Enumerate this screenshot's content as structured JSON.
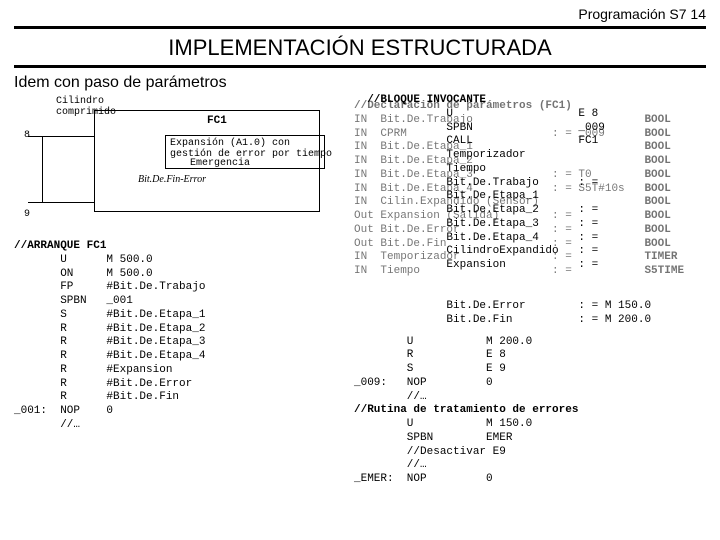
{
  "header": {
    "course": "Programación S7  14"
  },
  "title": "IMPLEMENTACIÓN ESTRUCTURADA",
  "subtitle": "Idem con paso de parámetros",
  "diagram": {
    "input_top": "Cilindro\ncomprimido",
    "fc_label": "FC1",
    "inner_text": "Expansión (A1.0) con\ngestión de error por tiempo",
    "port_in_top": "8",
    "port_in_bottom": "9",
    "out_top": "Emergencia",
    "out_bottom": "Error",
    "out_prefix": "Bit.De.Fin-"
  },
  "code_left": {
    "title": "//ARRANQUE FC1",
    "rows": [
      [
        "",
        "U",
        "M 500.0"
      ],
      [
        "",
        "ON",
        "M 500.0"
      ],
      [
        "",
        "FP",
        "#Bit.De.Trabajo"
      ],
      [
        "",
        "SPBN",
        "_001"
      ],
      [
        "",
        "S",
        "#Bit.De.Etapa_1"
      ],
      [
        "",
        "R",
        "#Bit.De.Etapa_2"
      ],
      [
        "",
        "R",
        "#Bit.De.Etapa_3"
      ],
      [
        "",
        "R",
        "#Bit.De.Etapa_4"
      ],
      [
        "",
        "R",
        "#Expansion"
      ],
      [
        "",
        "R",
        "#Bit.De.Error"
      ],
      [
        "",
        "R",
        "#Bit.De.Fin"
      ],
      [
        "_001:",
        "NOP",
        "0"
      ],
      [
        "",
        "//…",
        ""
      ]
    ]
  },
  "decl_back": {
    "title": "//Declaración de parámetros (FC1)",
    "rows": [
      [
        "IN",
        "Bit.De.Trabajo",
        "",
        "BOOL"
      ],
      [
        "IN",
        "CPRM",
        ": = _009",
        "BOOL"
      ],
      [
        "IN",
        "Bit.De.Etapa_1",
        "",
        "BOOL"
      ],
      [
        "IN",
        "Bit.De.Etapa_2",
        "",
        "BOOL"
      ],
      [
        "IN",
        "Bit.De.Etapa_3",
        ": = T0",
        "BOOL"
      ],
      [
        "IN",
        "Bit.De.Etapa_4",
        ": = S5T#10s",
        "BOOL"
      ],
      [
        "IN",
        "Cilin.Expandido (Sensor)",
        "",
        "BOOL"
      ],
      [
        "Out",
        "Expansion (Salida)",
        ": =",
        "BOOL"
      ],
      [
        "Out",
        "Bit.De.Error",
        ": =",
        "BOOL"
      ],
      [
        "Out",
        "Bit.De.Fin",
        ": =",
        "BOOL"
      ],
      [
        "IN",
        "Temporizador",
        ": =",
        "TIMER"
      ],
      [
        "IN",
        "Tiempo",
        ": =",
        "S5TIME"
      ]
    ],
    "tail": [
      [
        "",
        "Bit.De.Error",
        ": = M 150.0",
        ""
      ],
      [
        "",
        "Bit.De.Fin",
        ": = M 200.0",
        ""
      ]
    ]
  },
  "decl_front": {
    "title": "//BLOQUE INVOCANTE",
    "rows": [
      [
        "",
        "U",
        "E 8"
      ],
      [
        "",
        "SPBN",
        "_009"
      ],
      [
        "",
        "CALL",
        "FC1"
      ],
      [
        "",
        "Temporizador",
        ""
      ],
      [
        "",
        "Tiempo",
        ""
      ],
      [
        "",
        "Bit.De.Trabajo",
        ": ="
      ],
      [
        "",
        "Bit.De.Etapa_1",
        ""
      ],
      [
        "",
        "Bit.De.Etapa_2",
        ": ="
      ],
      [
        "",
        "Bit.De.Etapa_3",
        ": ="
      ],
      [
        "",
        "Bit.De.Etapa_4",
        ": ="
      ],
      [
        "",
        "CilindroExpandido",
        ": ="
      ],
      [
        "",
        "Expansion",
        ": ="
      ]
    ]
  },
  "code_right": {
    "rows": [
      [
        "",
        "U",
        "M 200.0"
      ],
      [
        "",
        "R",
        "E 8"
      ],
      [
        "",
        "S",
        "E 9"
      ],
      [
        "_009:",
        "NOP",
        "0"
      ],
      [
        "",
        "//…",
        ""
      ],
      [
        "//Rutina de tratamiento de errores",
        "",
        ""
      ],
      [
        "",
        "U",
        "M 150.0"
      ],
      [
        "",
        "SPBN",
        "EMER"
      ],
      [
        "",
        "//Desactivar E9",
        ""
      ],
      [
        "",
        "//…",
        ""
      ],
      [
        "_EMER:",
        "NOP",
        "0"
      ]
    ]
  }
}
